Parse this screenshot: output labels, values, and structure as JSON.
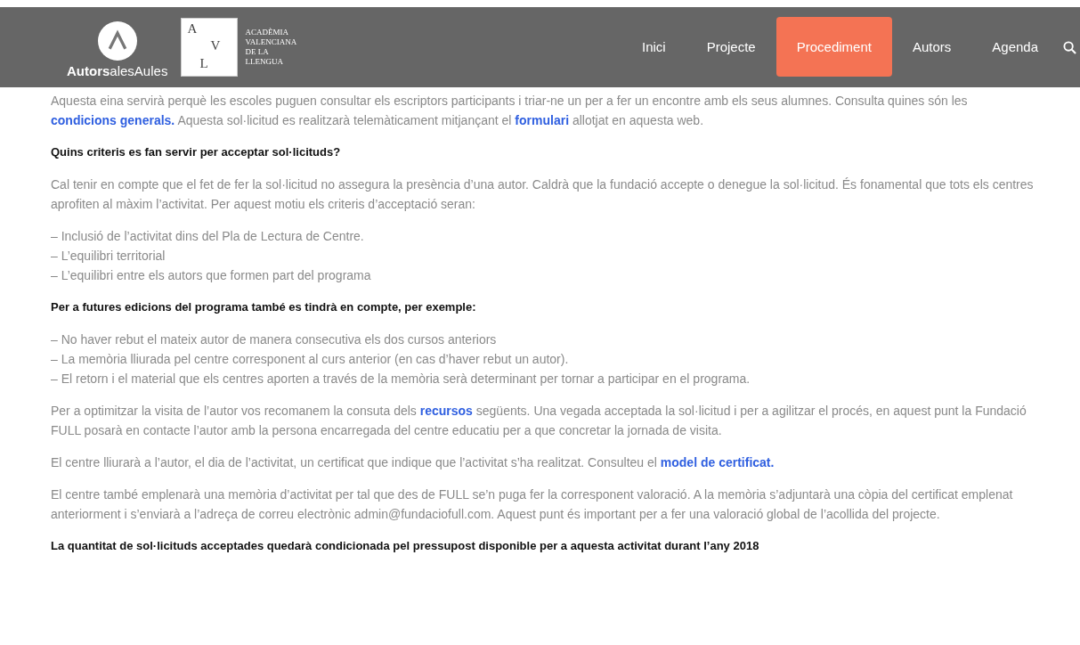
{
  "header": {
    "brand": "**Autors**alesAules",
    "academy_letters": [
      "A",
      "V",
      "L"
    ],
    "academy_name": [
      "ACADÈMIA",
      "VALENCIANA",
      "DE LA",
      "LLENGUA"
    ],
    "nav": [
      {
        "label": "Inici",
        "selected": false
      },
      {
        "label": "Projecte",
        "selected": false
      },
      {
        "label": "Procediment",
        "selected": true
      },
      {
        "label": "Autors",
        "selected": false
      },
      {
        "label": "Agenda",
        "selected": false
      }
    ]
  },
  "content": [
    {
      "kind": "para",
      "parts": [
        {
          "text": "Aquesta eina servirà perquè les escoles puguen consultar els escriptors participants i triar-ne un per a fer un encontre amb els seus alumnes. Consulta quines són les "
        },
        {
          "text": "condicions generals.",
          "kind": "link"
        },
        {
          "text": " Aquesta sol·licitud es realitzarà telemàticament mitjançant el "
        },
        {
          "text": "formulari",
          "kind": "link"
        },
        {
          "text": " allotjat en aquesta web."
        }
      ]
    },
    {
      "kind": "heading",
      "text": "Quins criteris es fan servir per acceptar sol·licituds?"
    },
    {
      "kind": "para",
      "parts": [
        {
          "text": "Cal tenir en compte que el fet de fer la sol·licitud no assegura la presència d’una autor. Caldrà que la fundació accepte o denegue la sol·licitud. És fonamental que tots els centres aprofiten al màxim l’activitat. Per aquest motiu els criteris d’acceptació seran:"
        }
      ]
    },
    {
      "kind": "list",
      "items": [
        "– Inclusió de l’activitat dins del Pla de Lectura de Centre.",
        "– L’equilibri territorial",
        "– L’equilibri entre els autors que formen part del programa"
      ]
    },
    {
      "kind": "heading",
      "text": "Per a futures edicions del programa també es tindrà en compte, per exemple:"
    },
    {
      "kind": "list",
      "items": [
        "– No haver rebut el mateix autor de manera consecutiva els dos cursos anteriors",
        "– La memòria lliurada pel centre corresponent al curs anterior (en cas d’haver rebut un autor).",
        "– El retorn i el material que els centres aporten a través de la memòria serà determinant per tornar a participar en el programa."
      ]
    },
    {
      "kind": "para",
      "parts": [
        {
          "text": "Per a optimitzar la visita de l’autor vos recomanem la consuta dels "
        },
        {
          "text": "recursos",
          "kind": "link"
        },
        {
          "text": " següents. Una vegada acceptada la sol·licitud i per a agilitzar el procés, en aquest punt la Fundació FULL posarà en contacte l’autor amb la persona encarregada del centre educatiu per a que concretar la jornada de visita."
        }
      ]
    },
    {
      "kind": "para",
      "parts": [
        {
          "text": "El centre lliurarà a l’autor, el dia de l’activitat, un certificat que indique que l’activitat s’ha realitzat.  Consulteu el "
        },
        {
          "text": "model de certificat.",
          "kind": "link"
        }
      ]
    },
    {
      "kind": "para",
      "parts": [
        {
          "text": "El centre també emplenarà una memòria d’activitat per tal que des de FULL se’n puga fer la corresponent valoració. A la memòria s’adjuntarà una còpia del certificat emplenat anteriorment i s’enviarà a l’adreça de correu electrònic admin@fundaciofull.com. Aquest punt és important per a fer una valoració global de l’acollida del projecte."
        }
      ]
    },
    {
      "kind": "heading",
      "text": "La quantitat de sol·licituds acceptades quedarà condicionada pel pressupost disponible per a aquesta activitat durant l’any 2018"
    }
  ]
}
